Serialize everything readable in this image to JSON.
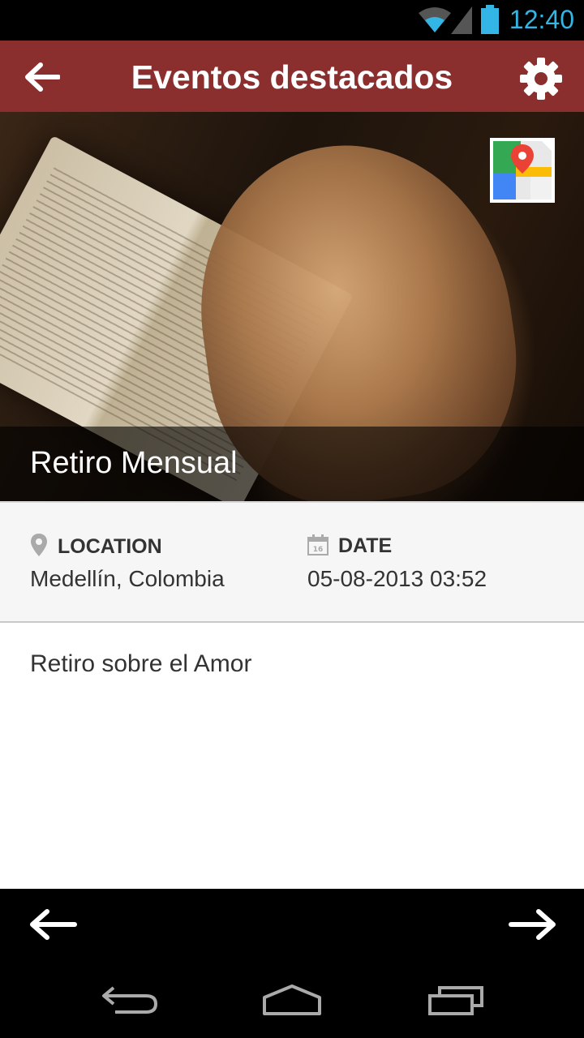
{
  "status_bar": {
    "time": "12:40",
    "icons": [
      "wifi-icon",
      "signal-icon",
      "battery-icon"
    ]
  },
  "app_bar": {
    "title": "Eventos destacados",
    "back_icon": "arrow-left-icon",
    "settings_icon": "gear-icon"
  },
  "event": {
    "name": "Retiro Mensual",
    "image": "praying-hands-on-bible",
    "map_icon": "maps-icon",
    "location_label": "LOCATION",
    "location_value": "Medellín, Colombia",
    "date_label": "DATE",
    "date_value": "05-08-2013 03:52",
    "description": "Retiro sobre el Amor"
  },
  "pager": {
    "prev_icon": "arrow-left-icon",
    "next_icon": "arrow-right-icon"
  },
  "system_nav": {
    "icons": [
      "back-icon",
      "home-icon",
      "recents-icon"
    ]
  },
  "colors": {
    "app_bar": "#8b2e2e",
    "status_clock": "#33b5e5",
    "nav_bar": "#000000"
  }
}
